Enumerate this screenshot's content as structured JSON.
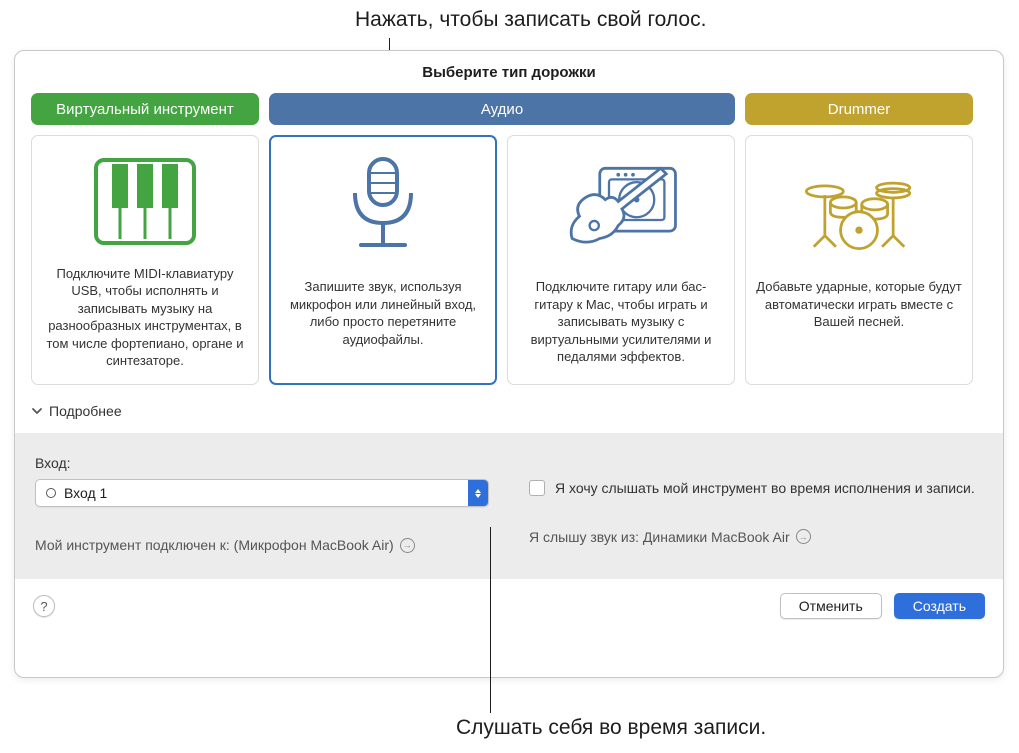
{
  "callouts": {
    "top": "Нажать, чтобы записать свой голос.",
    "bottom": "Слушать себя во время записи."
  },
  "dialog": {
    "title": "Выберите тип дорожки",
    "tabs": {
      "instrument": "Виртуальный инструмент",
      "audio": "Аудио",
      "drummer": "Drummer"
    },
    "cards": {
      "midi": "Подключите MIDI-клавиатуру USB, чтобы исполнять и записывать музыку на разнообразных инструментах, в том числе фортепиано, органе и синтезаторе.",
      "mic": "Запишите звук, используя микрофон или линейный вход, либо просто перетяните аудиофайлы.",
      "guitar": "Подключите гитару или бас-гитару к Mac, чтобы играть и записывать музыку с виртуальными усилителями и педалями эффектов.",
      "drummer": "Добавьте ударные, которые будут автоматически играть вместе с Вашей песней."
    },
    "details": {
      "toggle": "Подробнее",
      "input_label": "Вход:",
      "input_value": "Вход 1",
      "connected_to": "Мой инструмент подключен к: (Микрофон MacBook Air)",
      "monitor_checkbox": "Я хочу слышать мой инструмент во время исполнения и записи.",
      "hear_from": "Я слышу звук из: Динамики MacBook Air"
    },
    "footer": {
      "help": "?",
      "cancel": "Отменить",
      "create": "Создать"
    }
  }
}
